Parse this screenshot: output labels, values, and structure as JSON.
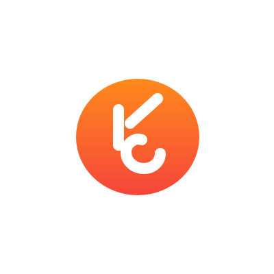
{
  "logo": {
    "icon": "ok-hand-icon",
    "colors": {
      "gradient_top": "#ff8a1c",
      "gradient_bottom": "#f5453a",
      "glyph": "#ffffff",
      "background": "#ffffff"
    }
  }
}
